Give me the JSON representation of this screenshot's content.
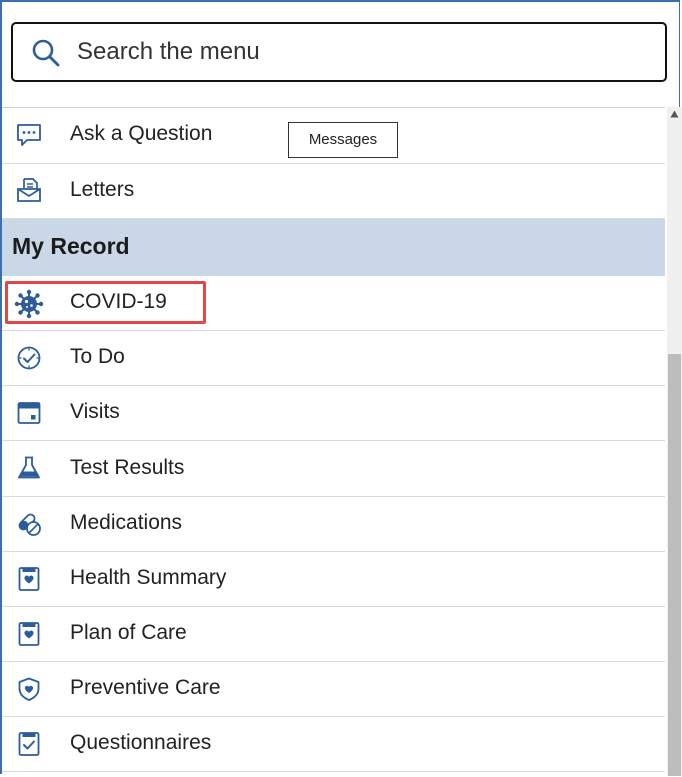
{
  "search": {
    "placeholder": "Search the menu"
  },
  "tooltip": "Messages",
  "menu": {
    "top_items": [
      {
        "label": "Ask a Question",
        "icon": "chat-bubble-icon"
      },
      {
        "label": "Letters",
        "icon": "letter-icon"
      }
    ],
    "section_title": "My Record",
    "record_items": [
      {
        "label": "COVID-19",
        "icon": "virus-icon"
      },
      {
        "label": "To Do",
        "icon": "check-clock-icon"
      },
      {
        "label": "Visits",
        "icon": "calendar-icon"
      },
      {
        "label": "Test Results",
        "icon": "flask-icon"
      },
      {
        "label": "Medications",
        "icon": "pills-icon"
      },
      {
        "label": "Health Summary",
        "icon": "heart-document-icon"
      },
      {
        "label": "Plan of Care",
        "icon": "heart-document-icon"
      },
      {
        "label": "Preventive Care",
        "icon": "shield-heart-icon"
      },
      {
        "label": "Questionnaires",
        "icon": "checkbox-document-icon"
      }
    ]
  },
  "colors": {
    "accent": "#3a6fb0",
    "section_bg": "#c9d7e7",
    "highlight": "#e04848",
    "icon": "#2c5d9a"
  }
}
